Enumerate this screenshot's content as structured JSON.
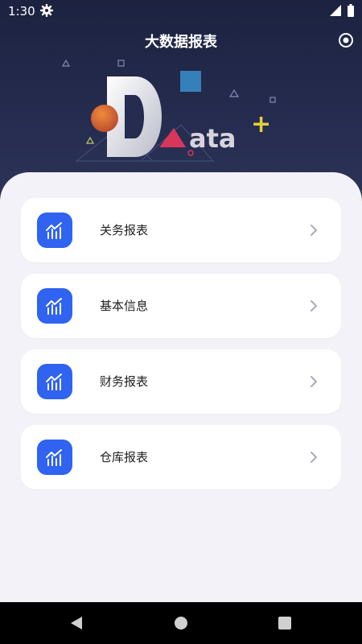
{
  "status": {
    "time": "1:30"
  },
  "header": {
    "title": "大数据报表"
  },
  "banner": {
    "logo_big_letter": "D",
    "logo_rest": "ata",
    "logo_plus": "+"
  },
  "menu": {
    "items": [
      {
        "label": "关务报表",
        "icon": "chart-icon"
      },
      {
        "label": "基本信息",
        "icon": "chart-icon"
      },
      {
        "label": "财务报表",
        "icon": "chart-icon"
      },
      {
        "label": "仓库报表",
        "icon": "chart-icon"
      }
    ]
  },
  "colors": {
    "accent": "#2f63f0",
    "header_bg": "#1c2240",
    "page_bg": "#f3f2f9"
  }
}
